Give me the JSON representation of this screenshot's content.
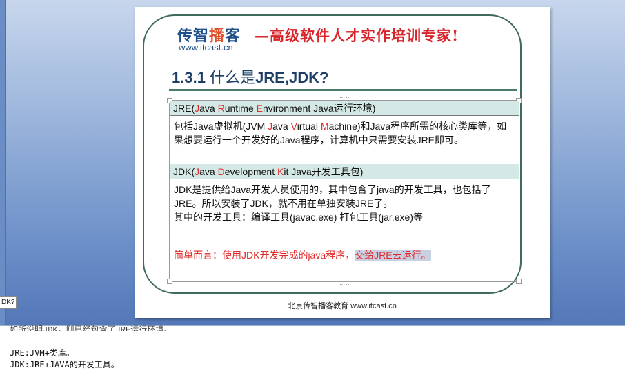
{
  "side_tab": "DK?",
  "slide": {
    "logo": {
      "cn_part1": "传智",
      "cn_hot": "播",
      "cn_part2": "客",
      "url": "www.itcast.cn"
    },
    "slogan": "—高级软件人才实作培训专家!",
    "title": {
      "number": "1.3.1",
      "prefix": " 什么是",
      "bold": "JRE,JDK?"
    },
    "jre": {
      "header_parts": [
        "JRE(",
        "J",
        "ava ",
        "R",
        "untime ",
        "E",
        "nvironment    Java运行环境)"
      ],
      "body_parts": [
        "包括Java虚拟机(JVM ",
        "J",
        "ava ",
        "V",
        "irtual ",
        "M",
        "achine)和Java程序所需的核心类库等，如果想要运行一个开发好的Java程序，计算机中只需要安装JRE即可。"
      ]
    },
    "jdk": {
      "header_parts": [
        "JDK(",
        "J",
        "ava ",
        "D",
        "evelopment  ",
        "K",
        "it    Java开发工具包)"
      ],
      "body_line1": "JDK是提供给Java开发人员使用的，其中包含了java的开发工具，也包括了JRE。所以安装了JDK，就不用在单独安装JRE了。",
      "body_line2": "其中的开发工具：编译工具(javac.exe) 打包工具(jar.exe)等"
    },
    "summary_plain": "简单而言：使用JDK开发完成的java程序，",
    "summary_highlight": "交给JRE去运行。",
    "footer": "北京传智播客教育 www.itcast.cn"
  },
  "notes": {
    "cut_line": "如所说明JDK，则已经包含了JRE运行环境。",
    "line1": "JRE:JVM+类库。",
    "line2": "JDK:JRE+JAVA的开发工具。"
  }
}
